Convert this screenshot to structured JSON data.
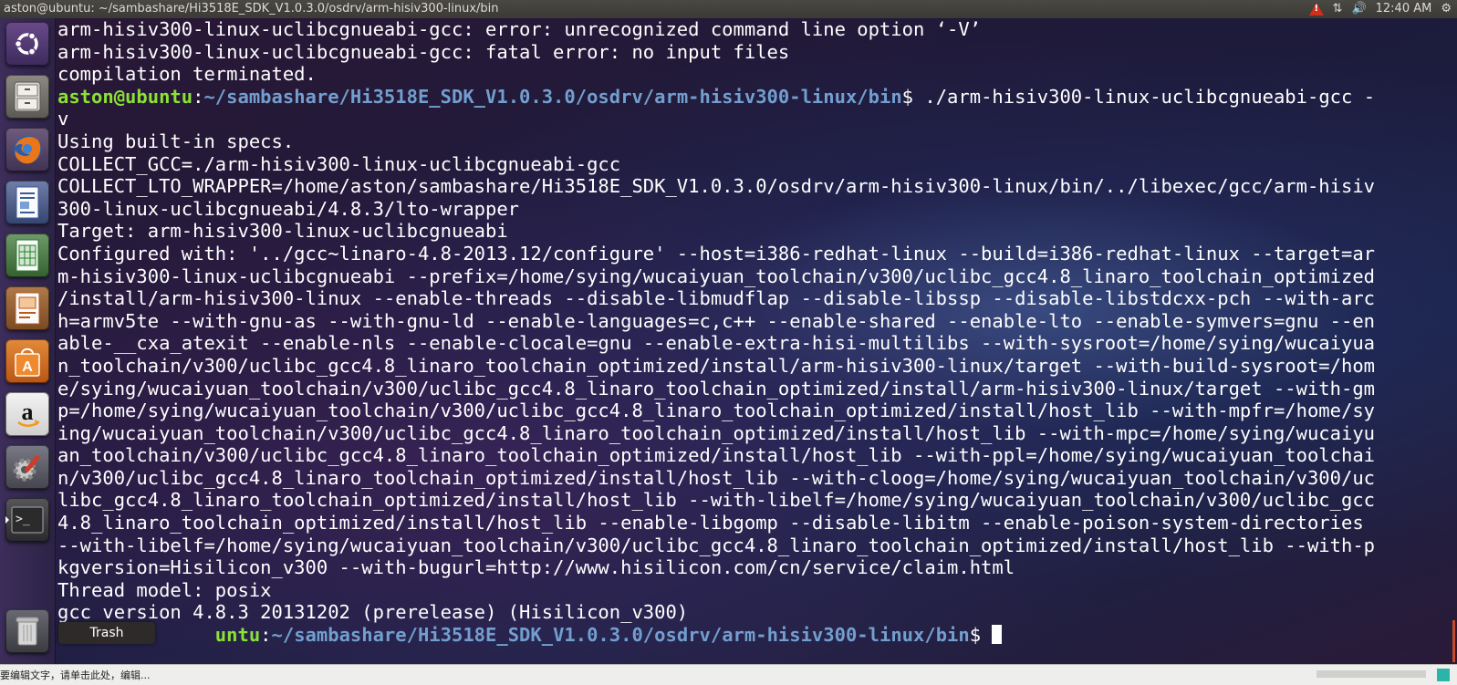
{
  "window": {
    "title": "aston@ubuntu: ~/sambashare/Hi3518E_SDK_V1.0.3.0/osdrv/arm-hisiv300-linux/bin"
  },
  "panel": {
    "clock": "12:40 AM"
  },
  "launcher": {
    "items": [
      {
        "name": "ubuntu-dash"
      },
      {
        "name": "files"
      },
      {
        "name": "firefox"
      },
      {
        "name": "libreoffice-writer"
      },
      {
        "name": "libreoffice-calc"
      },
      {
        "name": "libreoffice-impress"
      },
      {
        "name": "ubuntu-software-center"
      },
      {
        "name": "amazon"
      },
      {
        "name": "system-settings"
      },
      {
        "name": "terminal"
      }
    ],
    "trash_tooltip": "Trash"
  },
  "terminal": {
    "line_error1": "arm-hisiv300-linux-uclibcgnueabi-gcc: error: unrecognized command line option ‘-V’",
    "line_error2": "arm-hisiv300-linux-uclibcgnueabi-gcc: fatal error: no input files",
    "line_error3": "compilation terminated.",
    "prompt_user": "aston@ubuntu",
    "prompt_path": "~/sambashare/Hi3518E_SDK_V1.0.3.0/osdrv/arm-hisiv300-linux/bin",
    "command": "$ ./arm-hisiv300-linux-uclibcgnueabi-gcc -\nv",
    "output": "Using built-in specs.\nCOLLECT_GCC=./arm-hisiv300-linux-uclibcgnueabi-gcc\nCOLLECT_LTO_WRAPPER=/home/aston/sambashare/Hi3518E_SDK_V1.0.3.0/osdrv/arm-hisiv300-linux/bin/../libexec/gcc/arm-hisiv\n300-linux-uclibcgnueabi/4.8.3/lto-wrapper\nTarget: arm-hisiv300-linux-uclibcgnueabi\nConfigured with: '../gcc~linaro-4.8-2013.12/configure' --host=i386-redhat-linux --build=i386-redhat-linux --target=ar\nm-hisiv300-linux-uclibcgnueabi --prefix=/home/sying/wucaiyuan_toolchain/v300/uclibc_gcc4.8_linaro_toolchain_optimized\n/install/arm-hisiv300-linux --enable-threads --disable-libmudflap --disable-libssp --disable-libstdcxx-pch --with-arc\nh=armv5te --with-gnu-as --with-gnu-ld --enable-languages=c,c++ --enable-shared --enable-lto --enable-symvers=gnu --en\nable-__cxa_atexit --enable-nls --enable-clocale=gnu --enable-extra-hisi-multilibs --with-sysroot=/home/sying/wucaiyua\nn_toolchain/v300/uclibc_gcc4.8_linaro_toolchain_optimized/install/arm-hisiv300-linux/target --with-build-sysroot=/hom\ne/sying/wucaiyuan_toolchain/v300/uclibc_gcc4.8_linaro_toolchain_optimized/install/arm-hisiv300-linux/target --with-gm\np=/home/sying/wucaiyuan_toolchain/v300/uclibc_gcc4.8_linaro_toolchain_optimized/install/host_lib --with-mpfr=/home/sy\ning/wucaiyuan_toolchain/v300/uclibc_gcc4.8_linaro_toolchain_optimized/install/host_lib --with-mpc=/home/sying/wucaiyu\nan_toolchain/v300/uclibc_gcc4.8_linaro_toolchain_optimized/install/host_lib --with-ppl=/home/sying/wucaiyuan_toolchai\nn/v300/uclibc_gcc4.8_linaro_toolchain_optimized/install/host_lib --with-cloog=/home/sying/wucaiyuan_toolchain/v300/uc\nlibc_gcc4.8_linaro_toolchain_optimized/install/host_lib --with-libelf=/home/sying/wucaiyuan_toolchain/v300/uclibc_gcc\n4.8_linaro_toolchain_optimized/install/host_lib --enable-libgomp --disable-libitm --enable-poison-system-directories\n--with-libelf=/home/sying/wucaiyuan_toolchain/v300/uclibc_gcc4.8_linaro_toolchain_optimized/install/host_lib --with-p\nkgversion=Hisilicon_v300 --with-bugurl=http://www.hisilicon.com/cn/service/claim.html\nThread model: posix\ngcc version 4.8.3 20131202 (prerelease) (Hisilicon_v300)",
    "prompt_user_partial": "untu",
    "prompt_end": "$ "
  },
  "status_bar": {
    "text": "要编辑文字，请单击此处，编辑..."
  },
  "colors": {
    "prompt_user": "#8ae234",
    "prompt_path": "#729fcf",
    "launcher_bg": "#3c2d5a",
    "terminal_fg": "#ffffff"
  }
}
